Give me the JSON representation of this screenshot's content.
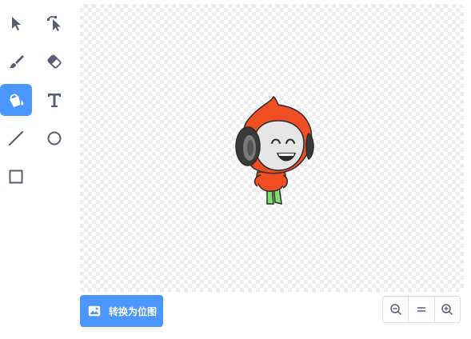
{
  "tools": [
    {
      "name": "select",
      "icon": "arrow-select-icon",
      "active": false
    },
    {
      "name": "reshape",
      "icon": "reshape-icon",
      "active": false
    },
    {
      "name": "brush",
      "icon": "brush-icon",
      "active": false
    },
    {
      "name": "eraser",
      "icon": "eraser-icon",
      "active": false
    },
    {
      "name": "fill",
      "icon": "fill-bucket-icon",
      "active": true
    },
    {
      "name": "text",
      "icon": "text-icon",
      "active": false
    },
    {
      "name": "line",
      "icon": "line-icon",
      "active": false
    },
    {
      "name": "circle",
      "icon": "circle-icon",
      "active": false
    },
    {
      "name": "rectangle",
      "icon": "rectangle-icon",
      "active": false
    }
  ],
  "canvas": {
    "sprite": "cartoon-character-with-headphones"
  },
  "convert_button": {
    "label": "转换为位图",
    "icon": "image-icon"
  },
  "zoom": {
    "zoom_out_icon": "zoom-out-icon",
    "reset_icon": "zoom-reset-icon",
    "zoom_in_icon": "zoom-in-icon"
  },
  "colors": {
    "accent": "#4C97FF",
    "icon": "#575E75",
    "character_orange": "#F04E23"
  }
}
